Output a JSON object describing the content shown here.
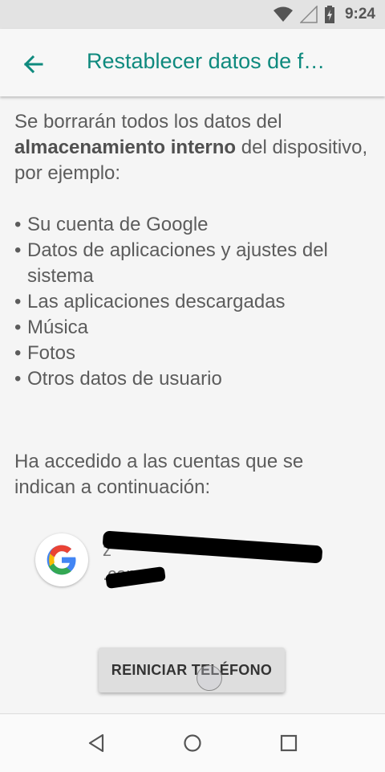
{
  "status_bar": {
    "time": "9:24",
    "icons": [
      "wifi-icon",
      "signal-icon",
      "battery-charging-icon"
    ]
  },
  "app_bar": {
    "title": "Restablecer datos de f…",
    "back_icon": "arrow-back-icon"
  },
  "content": {
    "intro_start": "Se borrarán todos los datos del ",
    "intro_bold": "almacenamiento interno",
    "intro_end": " del dispositivo, por ejemplo:",
    "items": [
      "Su cuenta de Google",
      "Datos de aplicaciones y ajustes del sistema",
      "Las aplicaciones descargadas",
      "Música",
      "Fotos",
      "Otros datos de usuario"
    ],
    "accounts_text": "Ha accedido a las cuentas que se indican a continuación:"
  },
  "account": {
    "icon": "google-icon",
    "email_line1": "z",
    "email_line2": ".com"
  },
  "reset_button": {
    "label": "REINICIAR TELÉFONO"
  },
  "nav_bar": {
    "icons": [
      "back-triangle-icon",
      "home-circle-icon",
      "recents-square-icon"
    ]
  },
  "colors": {
    "accent": "#0f8a7e",
    "background": "#f5f5f5",
    "button": "#dedede"
  }
}
